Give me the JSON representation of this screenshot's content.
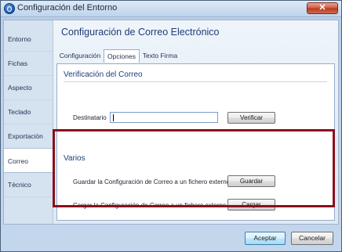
{
  "window": {
    "title": "Configuración del Entorno",
    "close_label": "✕"
  },
  "sidebar": {
    "items": [
      {
        "label": "Entorno"
      },
      {
        "label": "Fichas"
      },
      {
        "label": "Aspecto"
      },
      {
        "label": "Teclado"
      },
      {
        "label": "Exportación"
      },
      {
        "label": "Correo",
        "selected": true
      },
      {
        "label": "Técnico"
      }
    ]
  },
  "main": {
    "title": "Configuración de Correo Electrónico",
    "tabs": [
      {
        "label": "Configuración"
      },
      {
        "label": "Opciones",
        "selected": true
      },
      {
        "label": "Texto Firma"
      }
    ]
  },
  "verificacion": {
    "title": "Verificación del Correo",
    "destinatario_label": "Destinatario",
    "destinatario_value": "",
    "verificar_label": "Verificar"
  },
  "varios": {
    "title": "Varios",
    "guardar_text": "Guardar la Configuración de Correo a un fichero externo",
    "guardar_label": "Guardar",
    "cargar_text": "Cargar la Configuración de Correo a un fichero externo",
    "cargar_label": "Cargar"
  },
  "footer": {
    "accept_label": "Aceptar",
    "cancel_label": "Cancelar"
  },
  "colors": {
    "highlight": "#8b0f1b",
    "heading": "#1e3c78"
  }
}
